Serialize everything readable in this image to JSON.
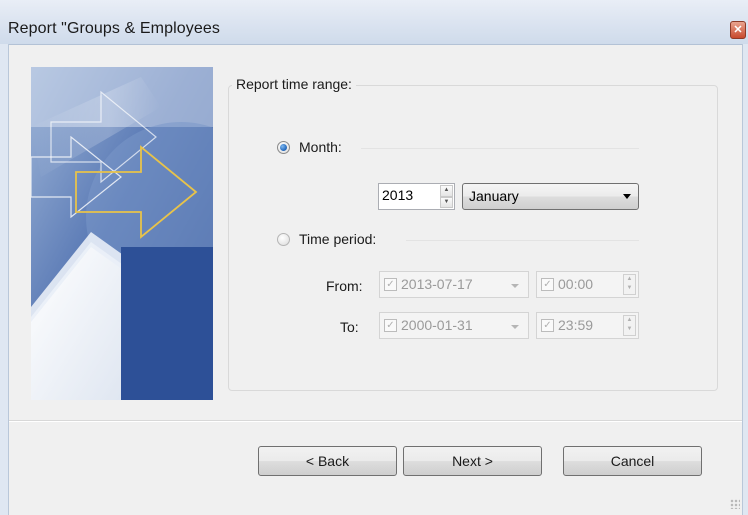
{
  "window": {
    "title": "Report \"Groups & Employees"
  },
  "group": {
    "legend": "Report time range:"
  },
  "month_option": {
    "label": "Month:",
    "year": "2013",
    "month": "January"
  },
  "period_option": {
    "label": "Time period:",
    "from_label": "From:",
    "to_label": "To:",
    "from_date": "2013-07-17",
    "from_time": "00:00",
    "to_date": "2000-01-31",
    "to_time": "23:59"
  },
  "buttons": {
    "back": "< Back",
    "next": "Next >",
    "cancel": "Cancel"
  },
  "icons": {
    "close": "close-icon",
    "checkbox": "checkbox-icon",
    "dropdown": "chevron-down-icon",
    "spinner": "spinner-arrows-icon"
  }
}
